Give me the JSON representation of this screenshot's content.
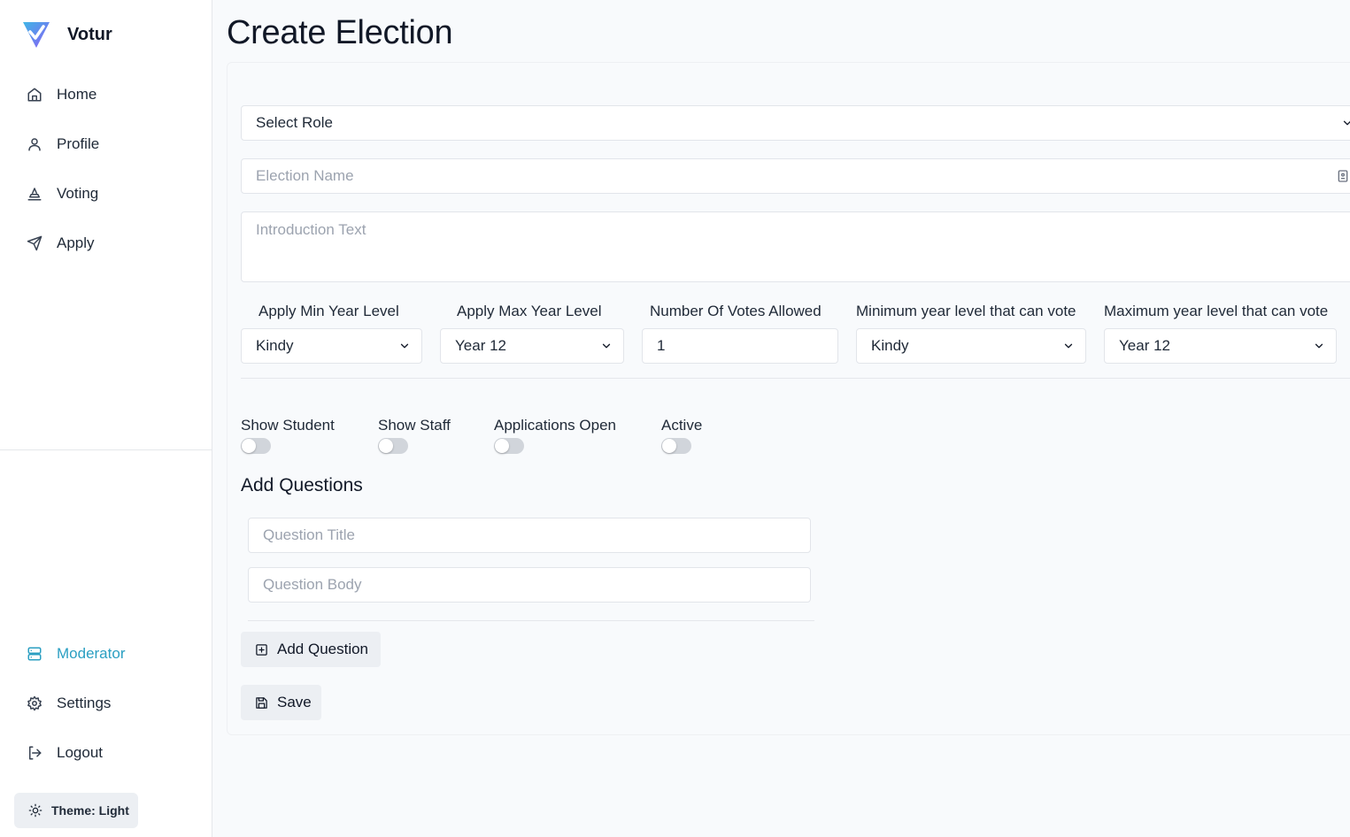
{
  "app": {
    "name": "Votur"
  },
  "sidebar": {
    "items": [
      {
        "label": "Home",
        "icon": "home-icon"
      },
      {
        "label": "Profile",
        "icon": "user-icon"
      },
      {
        "label": "Voting",
        "icon": "vote-icon"
      },
      {
        "label": "Apply",
        "icon": "send-icon"
      }
    ],
    "bottom_items": [
      {
        "label": "Moderator",
        "icon": "server-icon",
        "active": true
      },
      {
        "label": "Settings",
        "icon": "gear-icon"
      },
      {
        "label": "Logout",
        "icon": "logout-icon"
      }
    ],
    "theme_button": "Theme: Light",
    "accent_color": "#2b9fc2"
  },
  "page": {
    "title": "Create Election"
  },
  "form": {
    "role_select": {
      "value": "Select Role"
    },
    "election_name": {
      "placeholder": "Election Name"
    },
    "introduction": {
      "placeholder": "Introduction Text"
    },
    "apply_min_year": {
      "label": "Apply Min Year Level",
      "value": "Kindy"
    },
    "apply_max_year": {
      "label": "Apply Max Year Level",
      "value": "Year 12"
    },
    "votes_allowed": {
      "label": "Number Of Votes Allowed",
      "value": "1"
    },
    "min_vote_year": {
      "label": "Minimum year level that can vote",
      "value": "Kindy"
    },
    "max_vote_year": {
      "label": "Maximum year level that can vote",
      "value": "Year 12"
    },
    "toggles": [
      {
        "label": "Show Student",
        "on": false
      },
      {
        "label": "Show Staff",
        "on": false
      },
      {
        "label": "Applications Open",
        "on": false
      },
      {
        "label": "Active",
        "on": false
      }
    ]
  },
  "questions": {
    "heading": "Add Questions",
    "title_placeholder": "Question Title",
    "body_placeholder": "Question Body",
    "add_button": "Add Question"
  },
  "save_button": "Save"
}
